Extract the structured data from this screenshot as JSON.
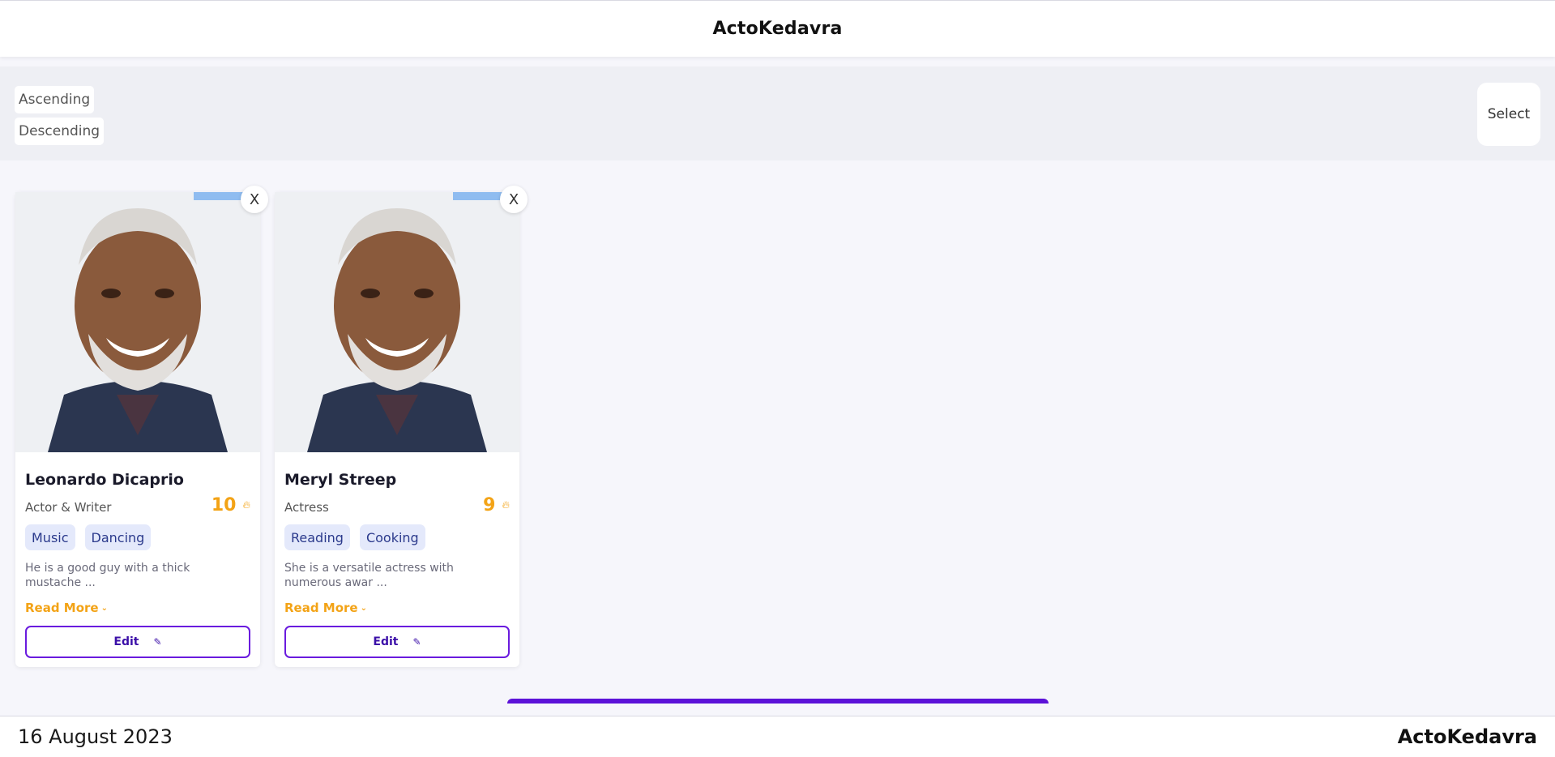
{
  "header": {
    "title": "ActoKedavra"
  },
  "controls": {
    "ascending_label": "Ascending",
    "descending_label": "Descending",
    "select_label": "Select"
  },
  "cards": [
    {
      "close_label": "X",
      "name": "Leonardo Dicaprio",
      "role": "Actor & Writer",
      "rating": "10",
      "tags": [
        "Music",
        "Dancing"
      ],
      "description": "He is a good guy with a thick mustache ...",
      "read_more": "Read More",
      "edit_label": "Edit"
    },
    {
      "close_label": "X",
      "name": "Meryl Streep",
      "role": "Actress",
      "rating": "9",
      "tags": [
        "Reading",
        "Cooking"
      ],
      "description": "She is a versatile actress with numerous awar ...",
      "read_more": "Read More",
      "edit_label": "Edit"
    }
  ],
  "footer": {
    "date": "16 August 2023",
    "brand": "ActoKedavra"
  },
  "colors": {
    "accent": "#5c12d8",
    "rating": "#f3a316",
    "tag_bg": "#e4e9fb",
    "tag_text": "#2b3a8c"
  },
  "icons": {
    "rating": "flame-icon",
    "edit": "pencil-icon",
    "read_more": "chevron-down-icon"
  }
}
